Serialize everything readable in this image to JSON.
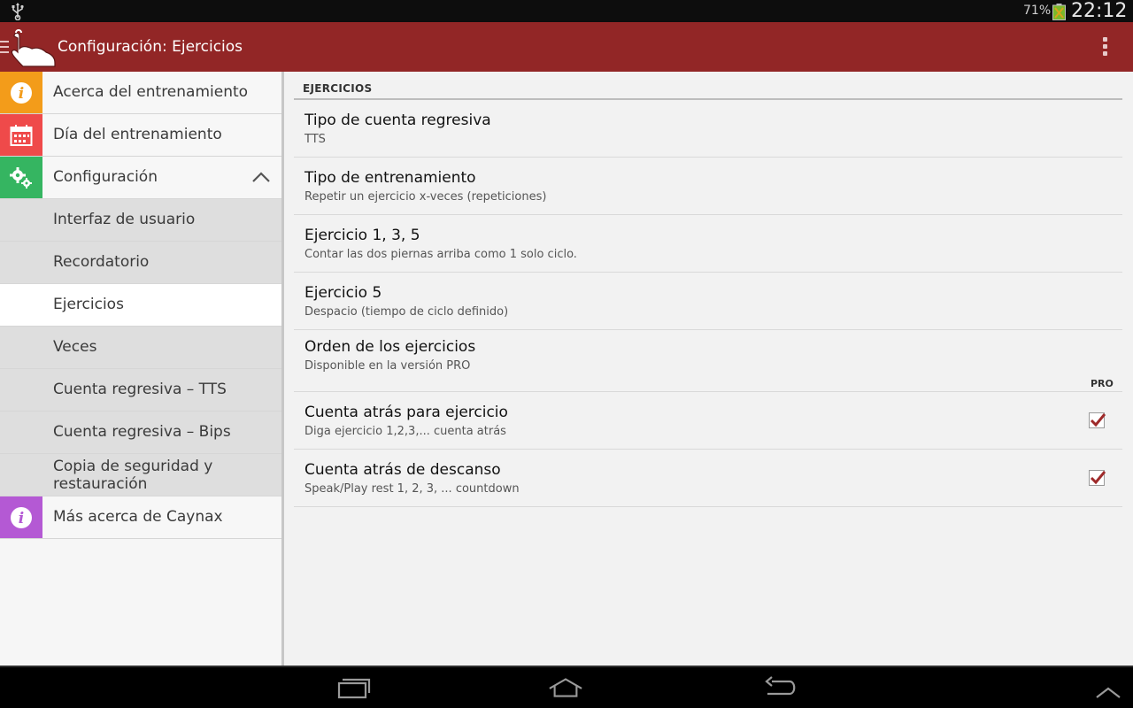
{
  "status_bar": {
    "battery_percent": "71%",
    "time": "22:12"
  },
  "app_bar": {
    "title": "Configuración: Ejercicios",
    "color": "#922626"
  },
  "nav": {
    "items": [
      {
        "label": "Acerca del entrenamiento",
        "icon": "info-icon",
        "color": "#f39c1a"
      },
      {
        "label": "Día del entrenamiento",
        "icon": "calendar-icon",
        "color": "#ef4a4a"
      },
      {
        "label": "Configuración",
        "icon": "gears-icon",
        "color": "#35b561",
        "expanded": true
      },
      {
        "label": "Interfaz de usuario"
      },
      {
        "label": "Recordatorio"
      },
      {
        "label": "Ejercicios",
        "active": true
      },
      {
        "label": "Veces"
      },
      {
        "label": "Cuenta regresiva – TTS"
      },
      {
        "label": "Cuenta regresiva – Bips"
      },
      {
        "label": "Copia de seguridad y restauración"
      },
      {
        "label": "Más acerca de Caynax",
        "icon": "info-icon",
        "color": "#b459d4"
      }
    ]
  },
  "content": {
    "section_header": "EJERCICIOS",
    "pro_badge": "PRO",
    "preferences": [
      {
        "title": "Tipo de cuenta regresiva",
        "summary": "TTS"
      },
      {
        "title": "Tipo de entrenamiento",
        "summary": "Repetir un ejercicio x-veces (repeticiones)"
      },
      {
        "title": "Ejercicio 1, 3, 5",
        "summary": "Contar las dos piernas arriba como 1 solo ciclo."
      },
      {
        "title": "Ejercicio 5",
        "summary": "Despacio (tiempo de ciclo definido)"
      },
      {
        "title": "Orden de los ejercicios",
        "summary": "Disponible en la versión PRO"
      },
      {
        "title": "Cuenta atrás para ejercicio",
        "summary": "Diga ejercicio 1,2,3,... cuenta atrás",
        "checked": true
      },
      {
        "title": "Cuenta atrás de descanso",
        "summary": "Speak/Play rest 1, 2, 3, ... countdown",
        "checked": true
      }
    ],
    "check_color": "#9e2a2a"
  }
}
